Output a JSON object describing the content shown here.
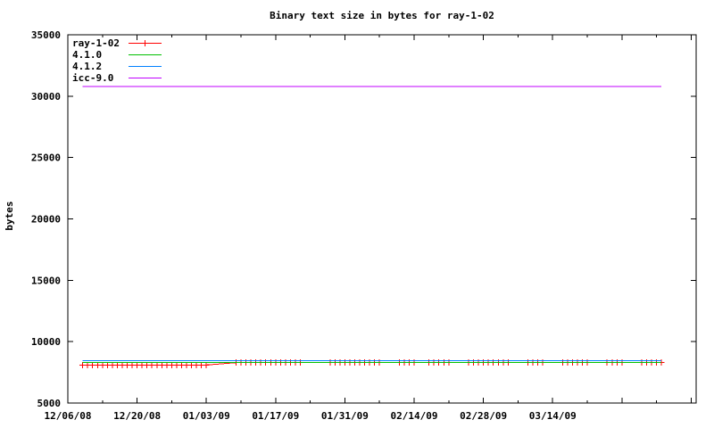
{
  "chart_data": {
    "type": "line",
    "title": "Binary text size in bytes for ray-1-02",
    "xlabel": "",
    "ylabel": "bytes",
    "background_color": "#ffffff",
    "axis_color": "#000000",
    "grid": "off",
    "legend_position": "top-left-inside",
    "x_axis": {
      "start_date": "2008-12-06",
      "range_days": 127,
      "tick_interval_days": 14,
      "minor_tick_interval_days": 7,
      "tick_labels": [
        "12/06/08",
        "12/20/08",
        "01/03/09",
        "01/17/09",
        "01/31/09",
        "02/14/09",
        "02/28/09",
        "03/14/09"
      ]
    },
    "y_axis": {
      "min": 5000,
      "max": 35000,
      "tick_step": 5000,
      "tick_labels": [
        "5000",
        "10000",
        "15000",
        "20000",
        "25000",
        "30000",
        "35000"
      ]
    },
    "series": [
      {
        "name": "ray-1-02",
        "color": "#ff0000",
        "style": "linespoints",
        "marker": "plus",
        "segments": [
          {
            "start": "2008-12-09",
            "end": "2009-01-03",
            "value": 8100
          },
          {
            "start": "2009-01-09",
            "end": "2009-04-05",
            "value": 8290
          }
        ],
        "marker_gaps": [
          {
            "start": "2009-01-23",
            "end": "2009-01-27"
          },
          {
            "start": "2009-02-08",
            "end": "2009-02-10"
          },
          {
            "start": "2009-02-15",
            "end": "2009-02-16"
          },
          {
            "start": "2009-02-22",
            "end": "2009-02-24"
          },
          {
            "start": "2009-03-06",
            "end": "2009-03-08"
          },
          {
            "start": "2009-03-13",
            "end": "2009-03-15"
          },
          {
            "start": "2009-03-22",
            "end": "2009-03-24"
          },
          {
            "start": "2009-03-29",
            "end": "2009-03-31"
          }
        ]
      },
      {
        "name": "4.1.0",
        "color": "#00c000",
        "style": "lines",
        "points": [
          {
            "date": "2008-12-09",
            "value": 8300
          },
          {
            "date": "2009-04-05",
            "value": 8300
          }
        ]
      },
      {
        "name": "4.1.2",
        "color": "#0080ff",
        "style": "lines",
        "points": [
          {
            "date": "2008-12-09",
            "value": 8450
          },
          {
            "date": "2009-04-05",
            "value": 8450
          }
        ]
      },
      {
        "name": "icc-9.0",
        "color": "#c000ff",
        "style": "lines",
        "points": [
          {
            "date": "2008-12-09",
            "value": 30800
          },
          {
            "date": "2009-04-05",
            "value": 30800
          }
        ]
      }
    ]
  }
}
